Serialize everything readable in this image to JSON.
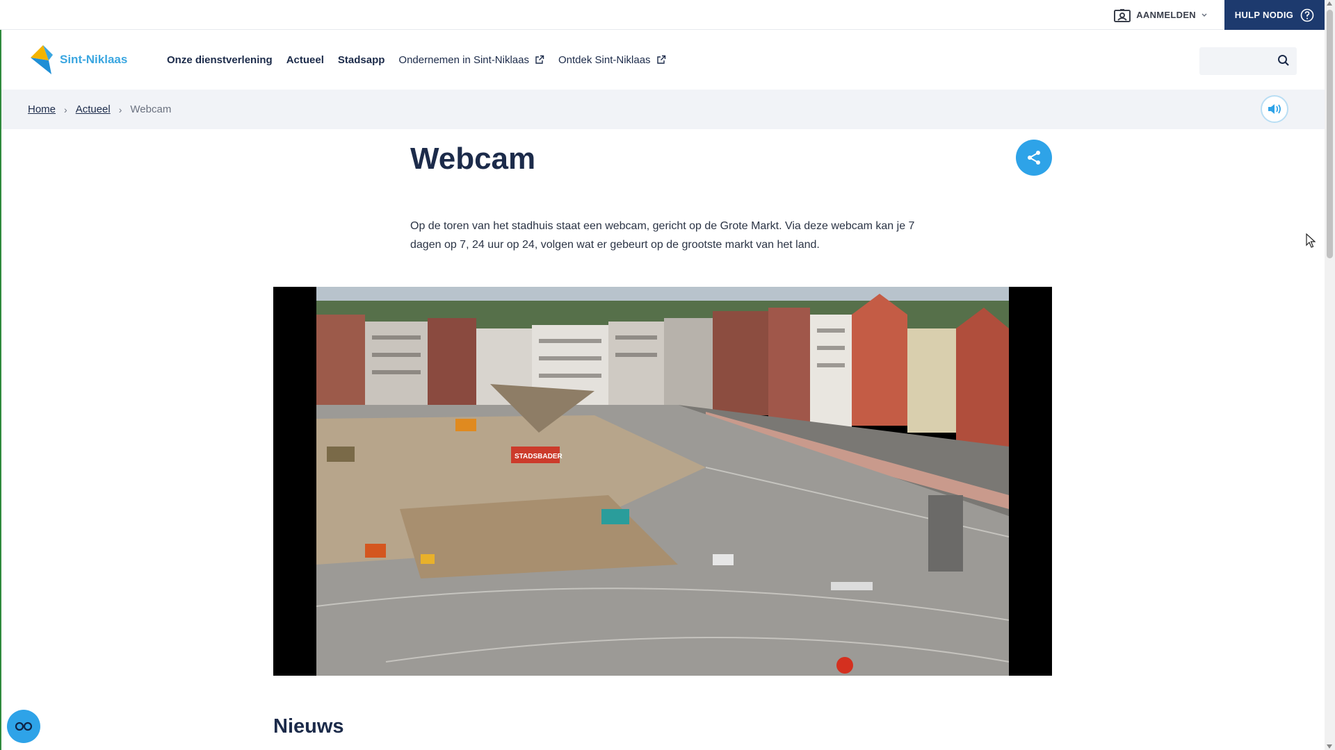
{
  "topbar": {
    "login_label": "AANMELDEN",
    "help_label": "HULP NODIG"
  },
  "header": {
    "logo_text": "Sint-Niklaas",
    "nav": [
      {
        "label": "Onze dienstverlening"
      },
      {
        "label": "Actueel"
      },
      {
        "label": "Stadsapp"
      },
      {
        "label": "Ondernemen in Sint-Niklaas"
      },
      {
        "label": "Ontdek Sint-Niklaas"
      }
    ],
    "search_placeholder": ""
  },
  "breadcrumb": {
    "items": [
      "Home",
      "Actueel"
    ],
    "current": "Webcam"
  },
  "page": {
    "title": "Webcam",
    "intro": "Op de toren van het stadhuis staat een webcam, gericht op de Grote Markt. Via deze webcam kan je 7 dagen op 7, 24 uur op 24, volgen wat er gebeurt op de grootste markt van het land.",
    "webcam_sign": "STADSBADER",
    "news_heading": "Nieuws"
  },
  "colors": {
    "brand_dark": "#1d3a6e",
    "accent_blue": "#2ea3e8",
    "text": "#1c2b4a"
  },
  "icons": {
    "login": "id-card-icon",
    "help": "question-circle-icon",
    "search": "search-icon",
    "audio": "speaker-icon",
    "share": "share-icon",
    "external": "external-link-icon",
    "accessibility": "accessibility-icon"
  }
}
